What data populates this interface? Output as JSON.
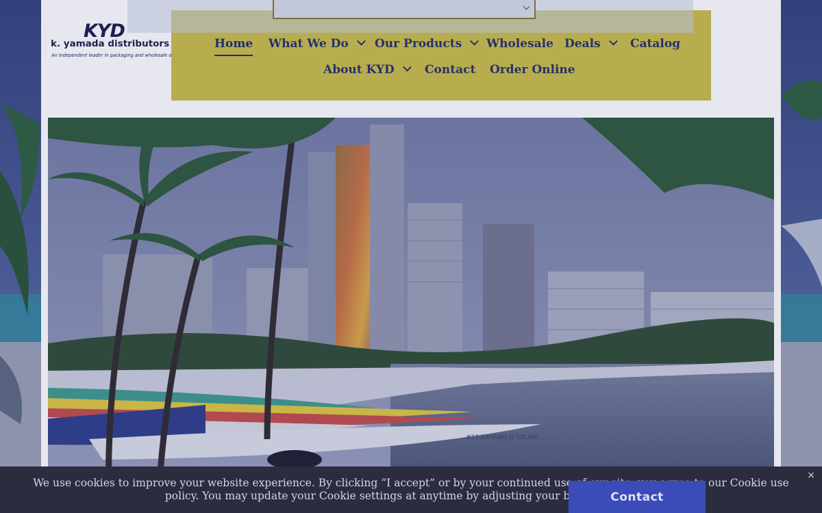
{
  "logo": {
    "mark": "KYD",
    "name": "k. yamada distributors",
    "tagline": "An independent leader in packaging and wholesale distribution"
  },
  "nav": {
    "items": [
      {
        "label": "Home",
        "active": true,
        "has_dropdown": false
      },
      {
        "label": "What We Do",
        "active": false,
        "has_dropdown": true
      },
      {
        "label": "Our Products",
        "active": false,
        "has_dropdown": true
      },
      {
        "label": "Wholesale",
        "active": false,
        "has_dropdown": false
      },
      {
        "label": "Deals",
        "active": false,
        "has_dropdown": true
      },
      {
        "label": "Catalog",
        "active": false,
        "has_dropdown": false
      },
      {
        "label": "About KYD",
        "active": false,
        "has_dropdown": true
      },
      {
        "label": "Contact",
        "active": false,
        "has_dropdown": false
      },
      {
        "label": "Order Online",
        "active": false,
        "has_dropdown": false
      }
    ]
  },
  "hero": {
    "canoe_labels": [
      "#23 KAHANU O 'IOLANI",
      "#23"
    ]
  },
  "cookie_banner": {
    "text": "We use cookies to improve your website experience. By clicking “I accept” or by your continued use of our site, you agree to our Cookie use policy. You may update your Cookie settings at anytime by adjusting your browser settings.",
    "close_label": "×"
  },
  "contact_tab": {
    "label": "Contact"
  },
  "colors": {
    "overlay": "#3e4d86",
    "nav_bg": "#b7ad4f",
    "nav_text": "#26306d",
    "cookie_bg": "#2b2d3f",
    "contact_bg": "#3b4bb8"
  }
}
